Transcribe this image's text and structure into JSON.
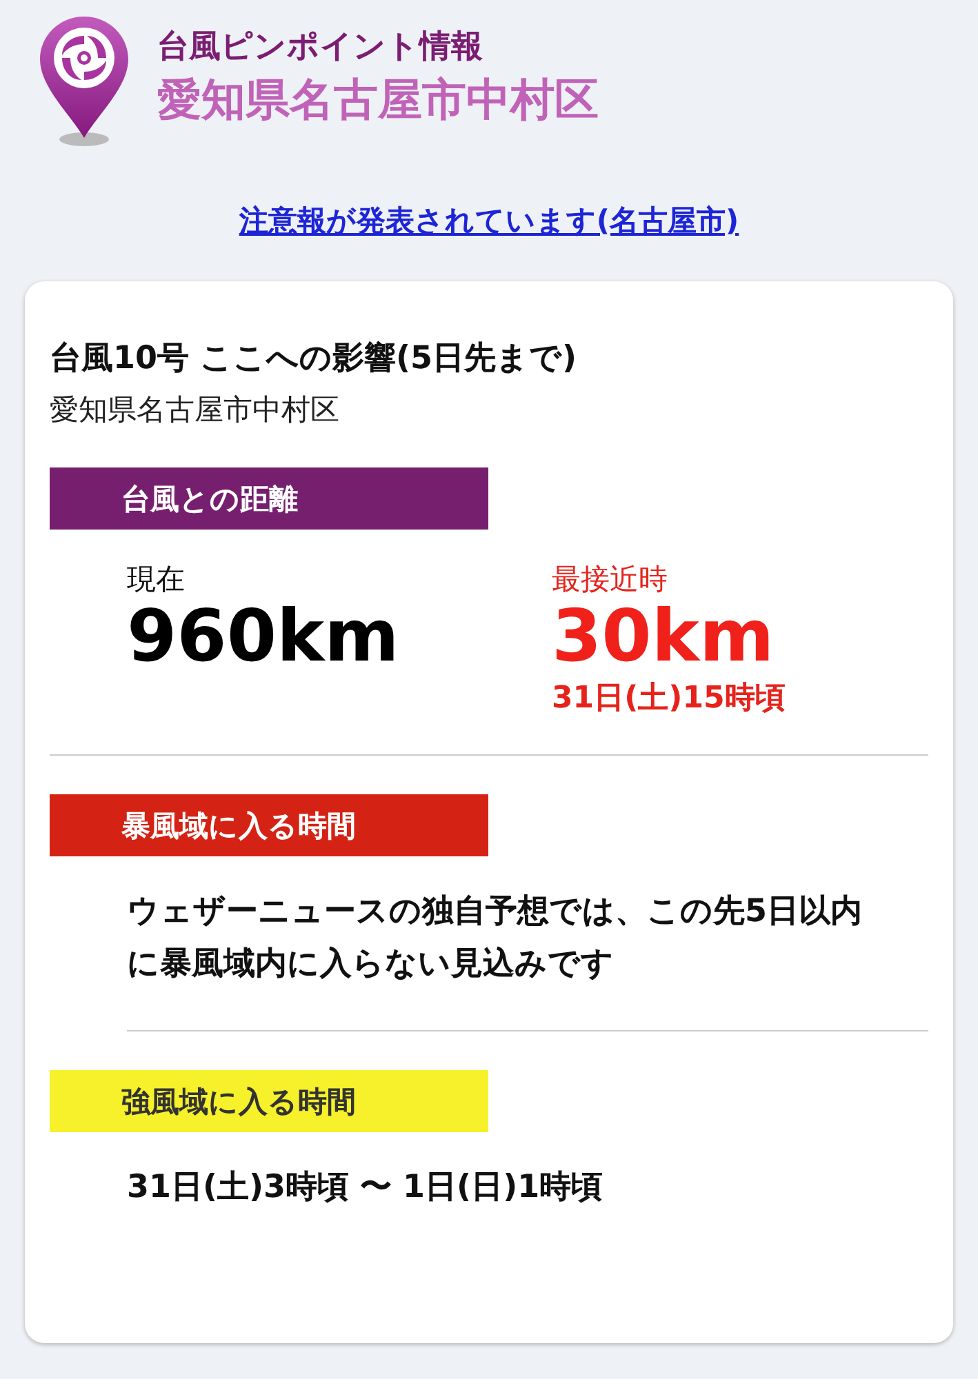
{
  "header": {
    "title": "台風ピンポイント情報",
    "location": "愛知県名古屋市中村区"
  },
  "alert_link": "注意報が発表されています(名古屋市)",
  "card": {
    "title": "台風10号 ここへの影響(5日先まで)",
    "subtitle": "愛知県名古屋市中村区",
    "sections": [
      {
        "kind": "distance",
        "heading": "台風との距離",
        "color": "#771f6f",
        "now_label": "現在",
        "now_value": "960km",
        "closest_label": "最接近時",
        "closest_value": "30km",
        "closest_time": "31日(土)15時頃"
      },
      {
        "kind": "message",
        "heading": "暴風域に入る時間",
        "color": "#d42314",
        "text": "ウェザーニュースの独自予想では、この先5日以内に暴風域内に入らない見込みです"
      },
      {
        "kind": "message",
        "heading": "強風域に入る時間",
        "color": "#f6f12a",
        "text": "31日(土)3時頃 〜 1日(日)1時頃"
      }
    ]
  }
}
